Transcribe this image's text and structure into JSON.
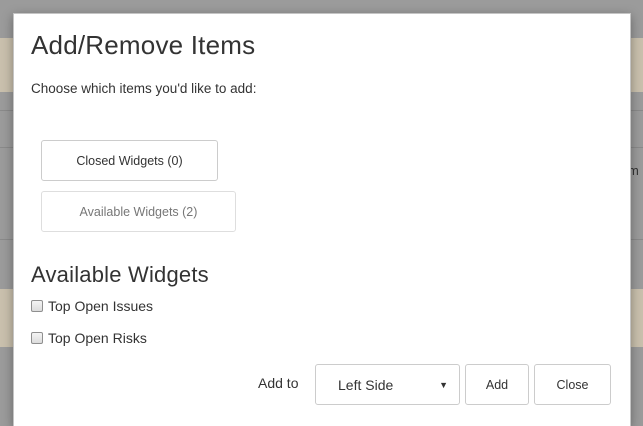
{
  "background": {
    "right_fragment": "m"
  },
  "modal": {
    "title": "Add/Remove Items",
    "subtitle": "Choose which items you'd like to add:",
    "closed_widgets_label": "Closed Widgets (0)",
    "available_widgets_label": "Available Widgets (2)",
    "section_title": "Available Widgets",
    "items": [
      {
        "label": "Top Open Issues",
        "checked": false
      },
      {
        "label": "Top Open Risks",
        "checked": false
      }
    ],
    "footer": {
      "add_to_label": "Add to",
      "select_value": "Left Side",
      "add_button": "Add",
      "close_button": "Close"
    }
  },
  "colors": {
    "overlay": "#9b9b9b",
    "band": "#c9c0ad",
    "modal_bg": "#ffffff",
    "border": "#cccccc"
  },
  "icons": {
    "select_arrow": "caret-down-icon"
  }
}
